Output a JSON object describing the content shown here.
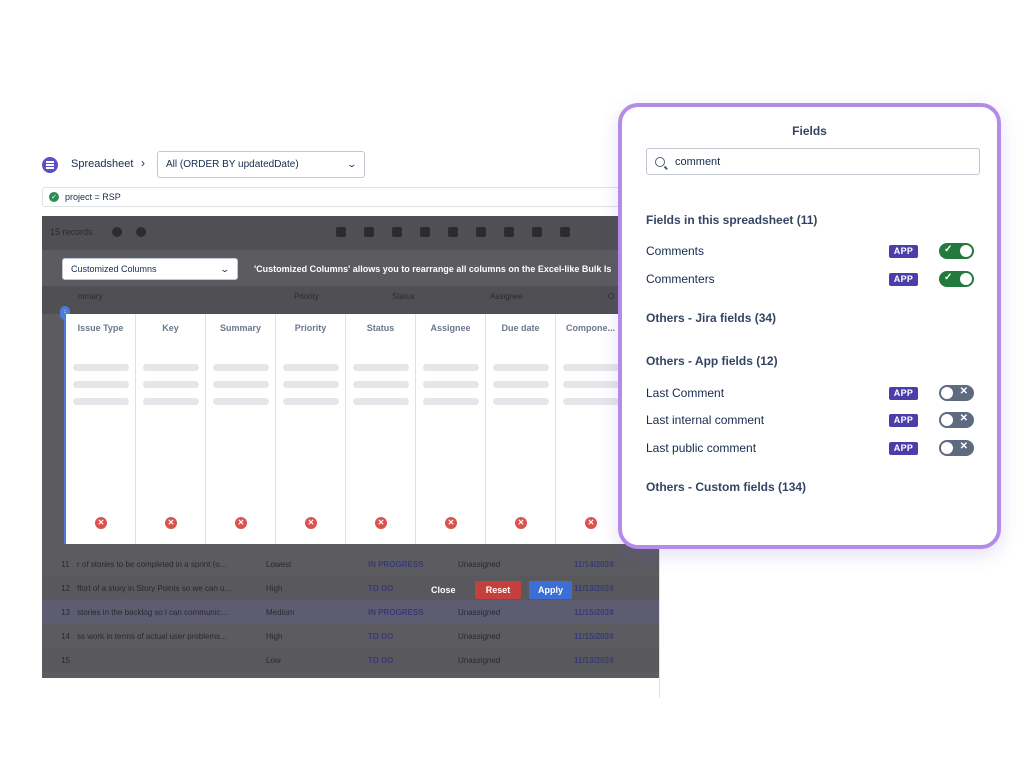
{
  "header": {
    "breadcrumb": "Spreadsheet",
    "separator": "›",
    "view_select": "All (ORDER BY updatedDate)",
    "jql": "project = RSP"
  },
  "sheet": {
    "records": "15 records",
    "column_select": "Customized Columns",
    "column_note": "'Customized Columns' allows you to rearrange all columns on the Excel-like Bulk Is",
    "old_headers": [
      "mmary",
      "Priority",
      "Status",
      "Assignee",
      "O"
    ],
    "columns": [
      "Issue Type",
      "Key",
      "Summary",
      "Priority",
      "Status",
      "Assignee",
      "Due date",
      "Compone..."
    ],
    "rows": [
      {
        "num": "11",
        "summary": "r of stories to be completed in a sprint (o...",
        "priority": "Lowest",
        "status": "IN PROGRESS",
        "assignee": "Unassigned",
        "due": "11/14/2024"
      },
      {
        "num": "12",
        "summary": "ffort of a story in Story Points so we can u...",
        "priority": "High",
        "status": "TO DO",
        "assignee": "",
        "due": "11/13/2024"
      },
      {
        "num": "13",
        "summary": "stories in the backlog so i can communic...",
        "priority": "Medium",
        "status": "IN PROGRESS",
        "assignee": "Unassigned",
        "due": "11/15/2024"
      },
      {
        "num": "14",
        "summary": "ss work in terms of actual user problems...",
        "priority": "High",
        "status": "TO DO",
        "assignee": "Unassigned",
        "due": "11/15/2024"
      },
      {
        "num": "15",
        "summary": "",
        "priority": "Low",
        "status": "TO DO",
        "assignee": "Unassigned",
        "due": "11/13/2024"
      }
    ],
    "close_label": "Close",
    "reset_label": "Reset",
    "apply_label": "Apply"
  },
  "fields_panel": {
    "title": "Fields",
    "search_value": "comment",
    "sections": {
      "in_sheet": "Fields in this spreadsheet (11)",
      "jira": "Others - Jira fields (34)",
      "app": "Others - App fields (12)",
      "custom": "Others - Custom fields (134)"
    },
    "in_sheet_items": [
      {
        "label": "Comments",
        "badge": "APP",
        "enabled": true
      },
      {
        "label": "Commenters",
        "badge": "APP",
        "enabled": true
      }
    ],
    "app_items": [
      {
        "label": "Last Comment",
        "badge": "APP",
        "enabled": false
      },
      {
        "label": "Last internal comment",
        "badge": "APP",
        "enabled": false
      },
      {
        "label": "Last public comment",
        "badge": "APP",
        "enabled": false
      }
    ]
  },
  "colors": {
    "accent": "#b48ce8",
    "app_badge": "#4c3ea8",
    "toggle_on": "#237a3e",
    "toggle_off": "#5e6a80",
    "reset": "#c4403c",
    "apply": "#3b6fd6"
  }
}
